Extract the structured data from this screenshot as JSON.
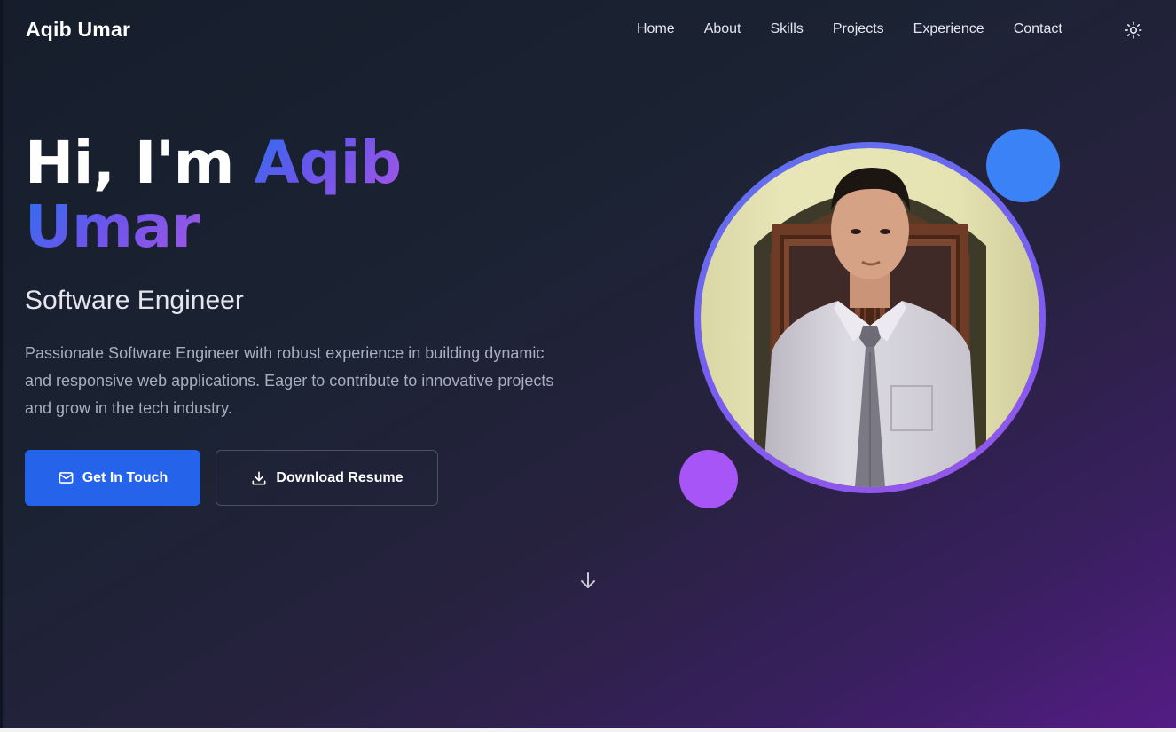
{
  "nav": {
    "brand": "Aqib Umar",
    "items": [
      "Home",
      "About",
      "Skills",
      "Projects",
      "Experience",
      "Contact"
    ],
    "theme_toggle_icon": "sun-icon"
  },
  "hero": {
    "greeting": "Hi, I'm",
    "name_first": "Aqib",
    "name_last": "Umar",
    "role": "Software Engineer",
    "bio": "Passionate Software Engineer with robust experience in building dynamic and responsive web applications. Eager to contribute to innovative projects and grow in the tech industry.",
    "primary_button": {
      "label": "Get In Touch",
      "icon": "mail-icon"
    },
    "secondary_button": {
      "label": "Download Resume",
      "icon": "download-icon"
    },
    "scroll_icon": "arrow-down-icon"
  },
  "colors": {
    "accent_blue": "#2563eb",
    "accent_purple": "#a855f7",
    "deco_blue": "#3b82f6"
  }
}
